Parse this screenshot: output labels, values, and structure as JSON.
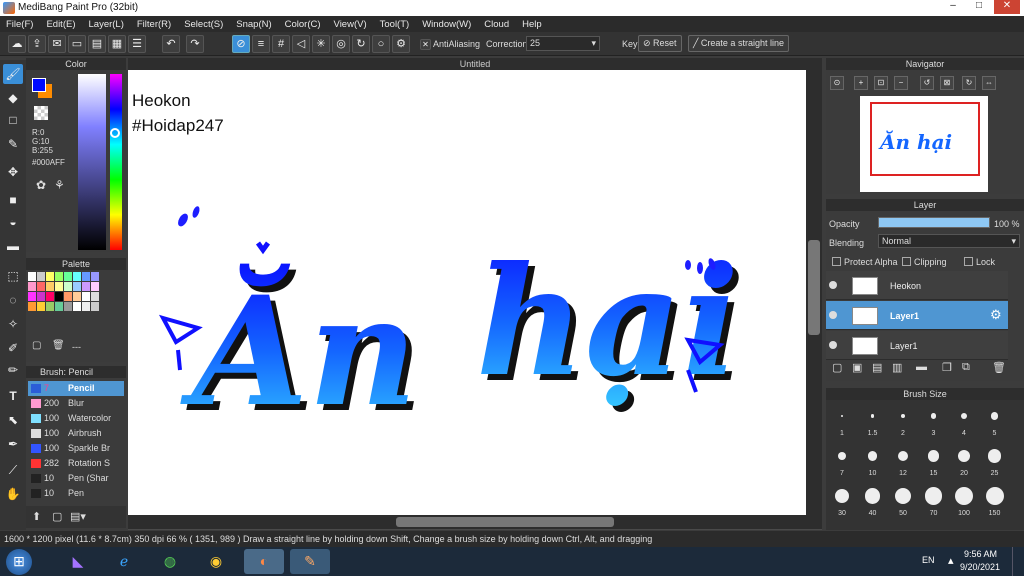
{
  "app": {
    "title": "MediBang Paint Pro (32bit)"
  },
  "window": {
    "minimize": "–",
    "maximize": "□",
    "close": "✕"
  },
  "menu": [
    "File(F)",
    "Edit(E)",
    "Layer(L)",
    "Filter(R)",
    "Select(S)",
    "Snap(N)",
    "Color(C)",
    "View(V)",
    "Tool(T)",
    "Window(W)",
    "Cloud",
    "Help"
  ],
  "toolbar": {
    "antialiasing_label": "AntiAliasing",
    "correction_label": "Correction",
    "correction_value": "25",
    "key_label": "Key",
    "reset_label": "Reset",
    "straight_line_label": "Create a straight line"
  },
  "color_panel": {
    "title": "Color",
    "r": "R:0",
    "g": "G:10",
    "b": "B:255",
    "hex": "#000AFF",
    "primary": "#000AFF",
    "secondary": "#FF8C00"
  },
  "palette_panel": {
    "title": "Palette",
    "dash": "---",
    "colors": [
      "#fff",
      "#ccc",
      "#ff6",
      "#9f6",
      "#6f9",
      "#6ff",
      "#69f",
      "#99f",
      "#f9c",
      "#f66",
      "#fc6",
      "#ff9",
      "#cfc",
      "#9cf",
      "#c9f",
      "#fcf",
      "#f3f",
      "#c3c",
      "#f06",
      "#000",
      "#f96",
      "#fc9",
      "#fff",
      "#ddd",
      "#f93",
      "#fc3",
      "#9c6",
      "#6c9",
      "#999",
      "#fff",
      "#eee",
      "#ccc"
    ]
  },
  "brush_panel": {
    "title": "Brush: Pencil",
    "brushes": [
      {
        "size": "7",
        "name": "Pencil",
        "color": "#2b5dd8",
        "selected": true
      },
      {
        "size": "200",
        "name": "Blur",
        "color": "#ff9bd0"
      },
      {
        "size": "100",
        "name": "Watercolor",
        "color": "#7fe0ff"
      },
      {
        "size": "100",
        "name": "Airbrush",
        "color": "#dddddd"
      },
      {
        "size": "100",
        "name": "Sparkle Br",
        "color": "#3355ff"
      },
      {
        "size": "282",
        "name": "Rotation S",
        "color": "#ff3333"
      },
      {
        "size": "10",
        "name": "Pen (Shar",
        "color": "#222222"
      },
      {
        "size": "10",
        "name": "Pen",
        "color": "#222222"
      }
    ]
  },
  "document": {
    "tab": "Untitled",
    "text_line1": "Heokon",
    "text_line2": "#Hoidap247",
    "art_word1": "Ăn",
    "art_word2": "hại"
  },
  "navigator": {
    "title": "Navigator"
  },
  "layer_panel": {
    "title": "Layer",
    "opacity_label": "Opacity",
    "opacity_value": "100 %",
    "opacity": 1.0,
    "blending_label": "Blending",
    "blending_value": "Normal",
    "protect_alpha": "Protect Alpha",
    "clipping": "Clipping",
    "lock": "Lock",
    "layers": [
      {
        "name": "Heokon",
        "selected": false
      },
      {
        "name": "Layer1",
        "selected": true
      },
      {
        "name": "Layer1",
        "selected": false
      }
    ]
  },
  "brush_size_panel": {
    "title": "Brush Size",
    "sizes": [
      "1",
      "1.5",
      "2",
      "3",
      "4",
      "5",
      "7",
      "10",
      "12",
      "15",
      "20",
      "25",
      "30",
      "40",
      "50",
      "70",
      "100",
      "150"
    ]
  },
  "status": {
    "text": "1600 * 1200 pixel  (11.6 * 8.7cm)  350 dpi  66 %  ( 1351, 989 )  Draw a straight line by holding down Shift, Change a brush size by holding down Ctrl, Alt, and dragging"
  },
  "taskbar": {
    "lang": "EN",
    "time": "9:56 AM",
    "date": "9/20/2021"
  }
}
